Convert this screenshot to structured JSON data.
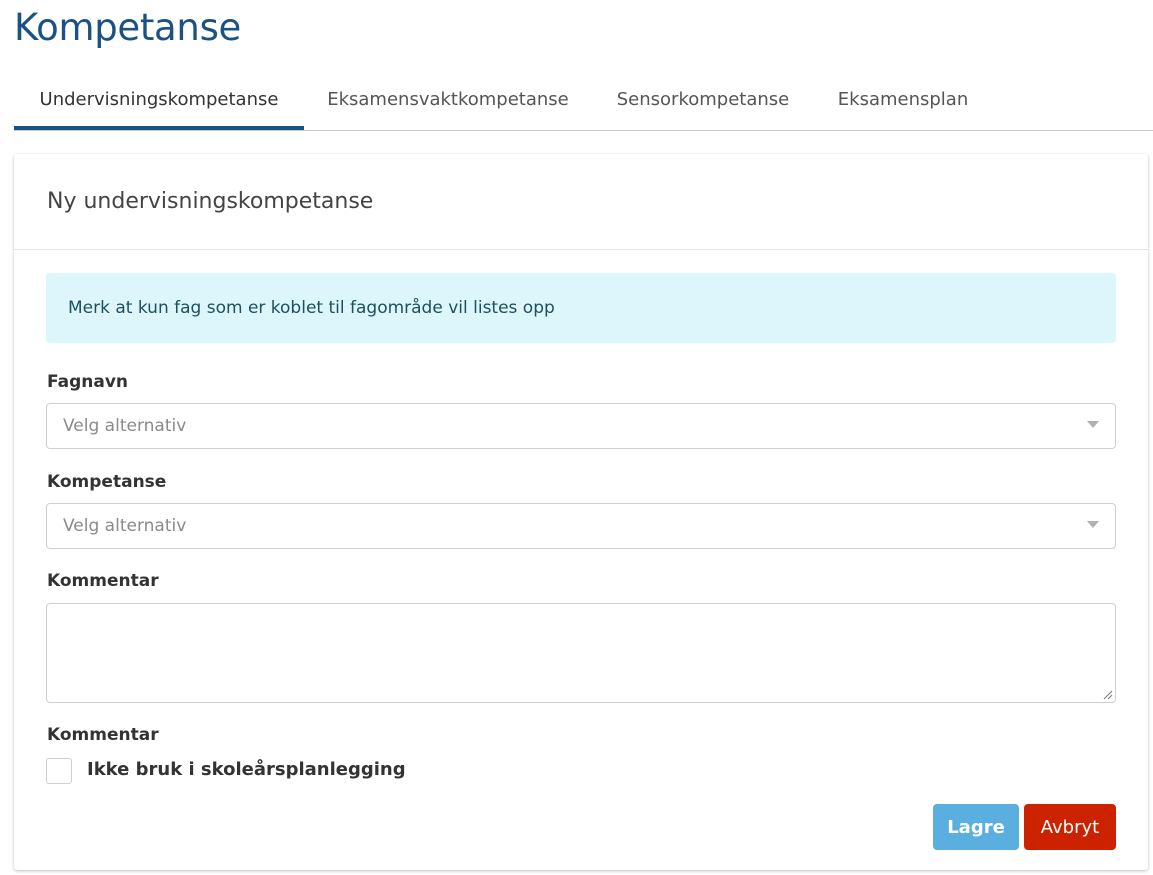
{
  "page": {
    "title": "Kompetanse"
  },
  "tabs": [
    {
      "label": "Undervisningskompetanse",
      "active": true
    },
    {
      "label": "Eksamensvaktkompetanse",
      "active": false
    },
    {
      "label": "Sensorkompetanse",
      "active": false
    },
    {
      "label": "Eksamensplan",
      "active": false
    }
  ],
  "card": {
    "title": "Ny undervisningskompetanse",
    "alert": "Merk at kun fag som er koblet til fagområde vil listes opp",
    "fields": {
      "fagnavn": {
        "label": "Fagnavn",
        "placeholder": "Velg alternativ"
      },
      "kompetanse": {
        "label": "Kompetanse",
        "placeholder": "Velg alternativ"
      },
      "kommentar": {
        "label": "Kommentar",
        "value": ""
      },
      "kommentar2": {
        "label": "Kommentar"
      }
    },
    "checkbox": {
      "label": "Ikke bruk i skoleårsplanlegging",
      "checked": false
    },
    "buttons": {
      "save": "Lagre",
      "cancel": "Avbryt"
    }
  },
  "colors": {
    "title": "#1b5283",
    "tab_active": "#1b5283",
    "alert_bg": "#dcf6fc",
    "save_button": "#5aaee0",
    "cancel_button": "#cc2200"
  }
}
